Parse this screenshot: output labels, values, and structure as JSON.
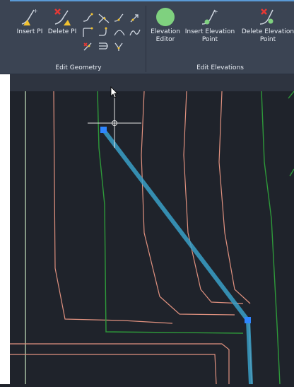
{
  "ribbon": {
    "groups": [
      {
        "label": "Edit Geometry"
      },
      {
        "label": "Edit Elevations"
      }
    ],
    "tools": {
      "insert_pi": "Insert PI",
      "delete_pi": "Delete PI",
      "elevation_editor_line1": "Elevation",
      "elevation_editor_line2": "Editor",
      "insert_elev_line1": "Insert Elevation",
      "insert_elev_line2": "Point",
      "delete_elev_line1": "Delete Elevation",
      "delete_elev_line2": "Point"
    }
  },
  "colors": {
    "ribbon_bg": "#3b4453",
    "canvas_bg": "#1f232b",
    "feature_line": "#3aa0c8",
    "grip": "#2e86ff",
    "contour_salmon": "#e0917f",
    "contour_green": "#2e9a3a",
    "elevation_editor_green": "#7fd17f",
    "delete_red": "#e53935",
    "warning_yellow": "#f2c230"
  }
}
